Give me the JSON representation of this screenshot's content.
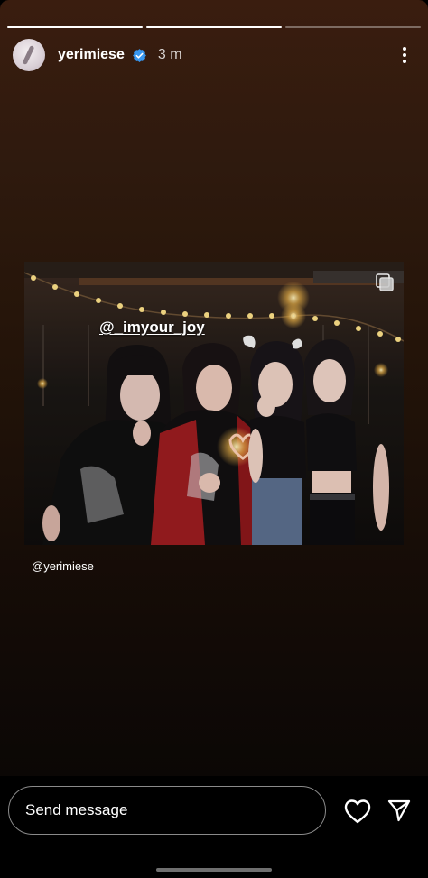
{
  "story": {
    "progress": [
      1,
      1,
      0
    ],
    "header": {
      "username": "yerimiese",
      "time": "3 m",
      "avatar_icon": "avatar-icon",
      "verified_icon": "verified-badge-icon",
      "more_icon": "more-vertical-icon"
    },
    "photo": {
      "mention": "@_imyour_joy"
    },
    "credit": "@yerimiese"
  },
  "footer": {
    "message_placeholder": "Send message",
    "heart_icon": "heart-icon",
    "send_icon": "send-icon"
  },
  "colors": {
    "background_top": "#3a1d0f",
    "background_bottom": "#0b0705",
    "verified_blue": "#3897f0",
    "text": "#ffffff"
  }
}
